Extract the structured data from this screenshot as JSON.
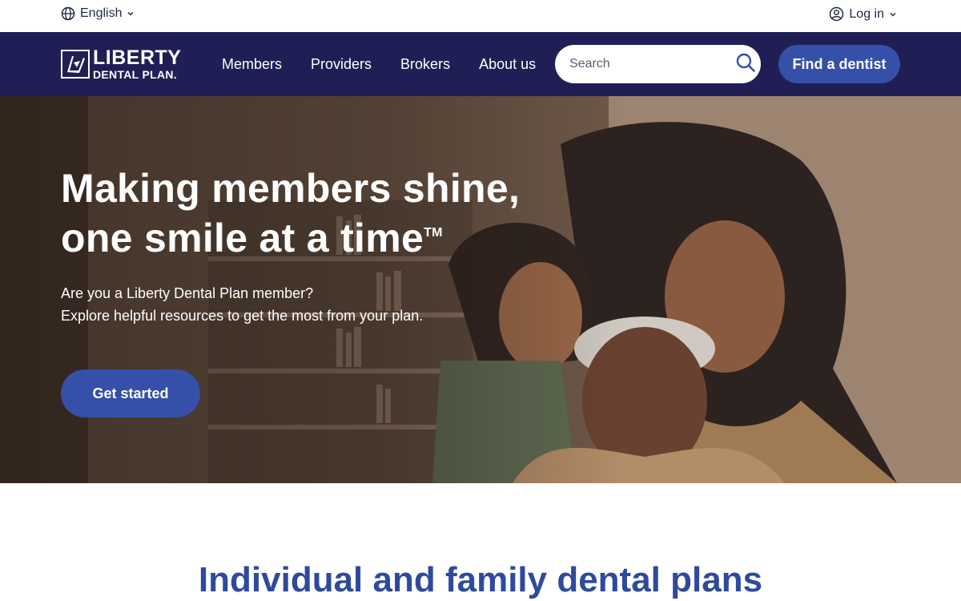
{
  "utility": {
    "language_label": "English",
    "login_label": "Log in"
  },
  "nav": {
    "logo_line1": "LIBERTY",
    "logo_line2": "DENTAL PLAN.",
    "links": [
      "Members",
      "Providers",
      "Brokers",
      "About us"
    ],
    "search_placeholder": "Search",
    "find_dentist_label": "Find a dentist"
  },
  "hero": {
    "title_line1": "Making members shine,",
    "title_line2": "one smile at a time",
    "trademark": "TM",
    "subtitle_line1": "Are you a Liberty Dental Plan member?",
    "subtitle_line2": "Explore helpful resources to get the most from your plan.",
    "cta_label": "Get started"
  },
  "section": {
    "title": "Individual and family dental plans"
  },
  "colors": {
    "navy": "#201f55",
    "brand_blue": "#3450a8",
    "heading_blue": "#2f4a9c"
  },
  "icons": {
    "language": "globe-icon",
    "login": "user-circle-icon",
    "dropdown": "chevron-down-icon",
    "search": "search-icon"
  }
}
